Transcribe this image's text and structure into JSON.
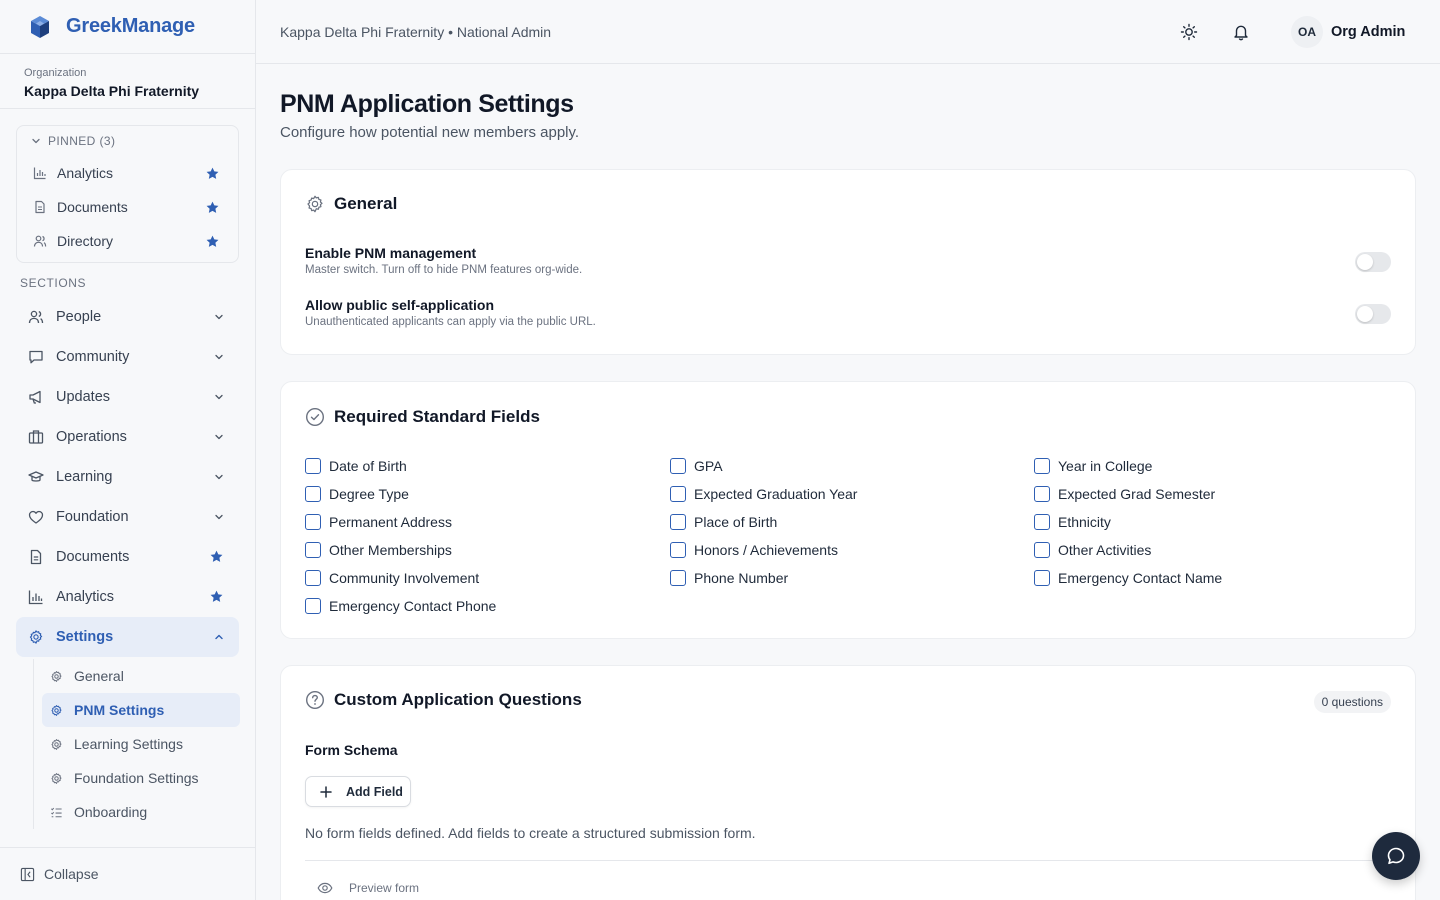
{
  "brand": {
    "name": "GreekManage"
  },
  "organization": {
    "label": "Organization",
    "name": "Kappa Delta Phi Fraternity"
  },
  "pinned": {
    "header": "PINNED (3)",
    "items": [
      {
        "label": "Analytics",
        "icon": "bar-chart-icon"
      },
      {
        "label": "Documents",
        "icon": "document-icon"
      },
      {
        "label": "Directory",
        "icon": "people-icon"
      }
    ]
  },
  "sections": {
    "title": "SECTIONS",
    "items": [
      {
        "label": "People",
        "icon": "people-icon",
        "trail": "chevron-down"
      },
      {
        "label": "Community",
        "icon": "chat-icon",
        "trail": "chevron-down"
      },
      {
        "label": "Updates",
        "icon": "megaphone-icon",
        "trail": "chevron-down"
      },
      {
        "label": "Operations",
        "icon": "building-icon",
        "trail": "chevron-down"
      },
      {
        "label": "Learning",
        "icon": "graduation-cap-icon",
        "trail": "chevron-down"
      },
      {
        "label": "Foundation",
        "icon": "heart-icon",
        "trail": "chevron-down"
      },
      {
        "label": "Documents",
        "icon": "document-icon",
        "trail": "star"
      },
      {
        "label": "Analytics",
        "icon": "bar-chart-icon",
        "trail": "star"
      },
      {
        "label": "Settings",
        "icon": "gear-icon",
        "trail": "chevron-up",
        "active": true
      }
    ],
    "settings_sub": [
      {
        "label": "General"
      },
      {
        "label": "PNM Settings",
        "active": true
      },
      {
        "label": "Learning Settings"
      },
      {
        "label": "Foundation Settings"
      },
      {
        "label": "Onboarding"
      }
    ]
  },
  "collapse_label": "Collapse",
  "topbar": {
    "breadcrumb": "Kappa Delta Phi Fraternity • National Admin",
    "avatar_initials": "OA",
    "user_name": "Org Admin"
  },
  "page": {
    "title": "PNM Application Settings",
    "subtitle": "Configure how potential new members apply."
  },
  "general": {
    "title": "General",
    "settings": [
      {
        "title": "Enable PNM management",
        "description": "Master switch. Turn off to hide PNM features org-wide.",
        "enabled": false
      },
      {
        "title": "Allow public self-application",
        "description": "Unauthenticated applicants can apply via the public URL.",
        "enabled": false
      }
    ]
  },
  "required_fields": {
    "title": "Required Standard Fields",
    "columns": [
      [
        "Date of Birth",
        "Degree Type",
        "Permanent Address",
        "Other Memberships",
        "Community Involvement",
        "Emergency Contact Phone"
      ],
      [
        "GPA",
        "Expected Graduation Year",
        "Place of Birth",
        "Honors / Achievements",
        "Phone Number"
      ],
      [
        "Year in College",
        "Expected Grad Semester",
        "Ethnicity",
        "Other Activities",
        "Emergency Contact Name"
      ]
    ]
  },
  "custom_questions": {
    "title": "Custom Application Questions",
    "count_badge": "0 questions",
    "schema_label": "Form Schema",
    "add_button": "Add Field",
    "empty_message": "No form fields defined. Add fields to create a structured submission form.",
    "preview_label": "Preview form"
  },
  "colors": {
    "accent": "#2f5fb3",
    "active_bg": "#e7edf8",
    "fab_bg": "#1e2a3d"
  }
}
